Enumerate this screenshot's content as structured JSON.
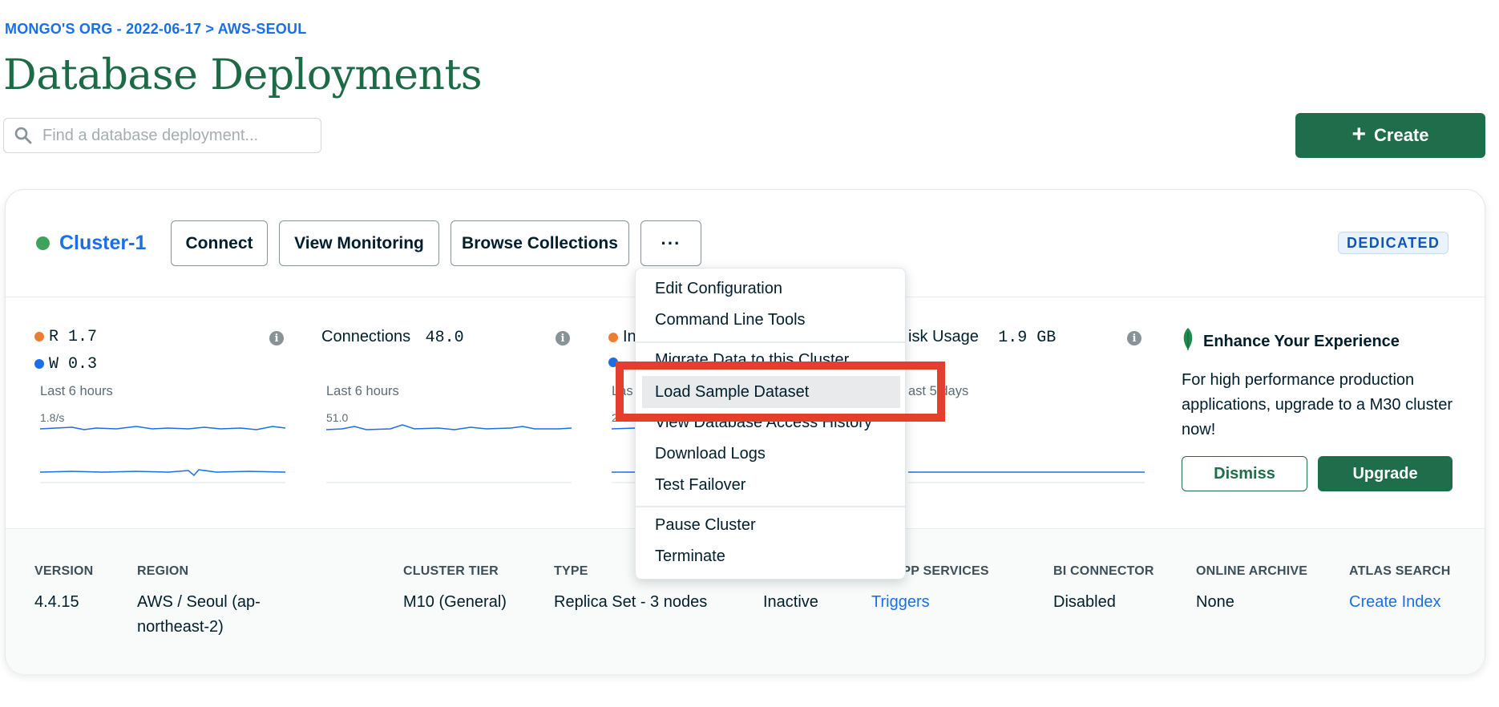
{
  "breadcrumb": "MONGO'S ORG - 2022-06-17 > AWS-SEOUL",
  "page_title": "Database Deployments",
  "search": {
    "placeholder": "Find a database deployment..."
  },
  "create_button": {
    "icon": "+",
    "label": "Create"
  },
  "cluster": {
    "status_color": "#3fa25a",
    "name": "Cluster-1",
    "buttons": {
      "connect": "Connect",
      "monitoring": "View Monitoring",
      "collections": "Browse Collections",
      "more": "···"
    },
    "badge": "DEDICATED"
  },
  "metrics": {
    "ops": {
      "r_label": "R",
      "r_value": "1.7",
      "w_label": "W",
      "w_value": "0.3",
      "period": "Last 6 hours",
      "scale": "1.8/s",
      "r_color": "#ed7d31",
      "w_color": "#1a6ee8"
    },
    "connections": {
      "label": "Connections",
      "value": "48.0",
      "period": "Last 6 hours",
      "scale": "51.0"
    },
    "network": {
      "label_partial": "In",
      "period_partial": "Las",
      "scale_partial": "2"
    },
    "disk": {
      "label_partial": "isk Usage",
      "value": "1.9 GB",
      "period_partial": "ast 5 days"
    }
  },
  "enhance": {
    "title": "Enhance Your Experience",
    "text": "For high performance production applications, upgrade to a M30 cluster now!",
    "dismiss": "Dismiss",
    "upgrade": "Upgrade",
    "icon": "leaf-icon"
  },
  "footer": {
    "version": {
      "head": "VERSION",
      "value": "4.4.15"
    },
    "region": {
      "head": "REGION",
      "value": "AWS / Seoul (ap-northeast-2)"
    },
    "tier": {
      "head": "CLUSTER TIER",
      "value": "M10 (General)"
    },
    "type": {
      "head": "TYPE",
      "value": "Replica Set - 3 nodes"
    },
    "backups": {
      "value": "Inactive"
    },
    "app_services": {
      "head": "ED APP SERVICES",
      "value": "Triggers"
    },
    "bi": {
      "head": "BI CONNECTOR",
      "value": "Disabled"
    },
    "archive": {
      "head": "ONLINE ARCHIVE",
      "value": "None"
    },
    "search": {
      "head": "ATLAS SEARCH",
      "value": "Create Index"
    }
  },
  "menu": {
    "items": [
      "Edit Configuration",
      "Command Line Tools",
      "Migrate Data to this Cluster",
      "Load Sample Dataset",
      "View Database Access History",
      "Download Logs",
      "Test Failover",
      "Pause Cluster",
      "Terminate"
    ],
    "highlighted": "Load Sample Dataset"
  }
}
